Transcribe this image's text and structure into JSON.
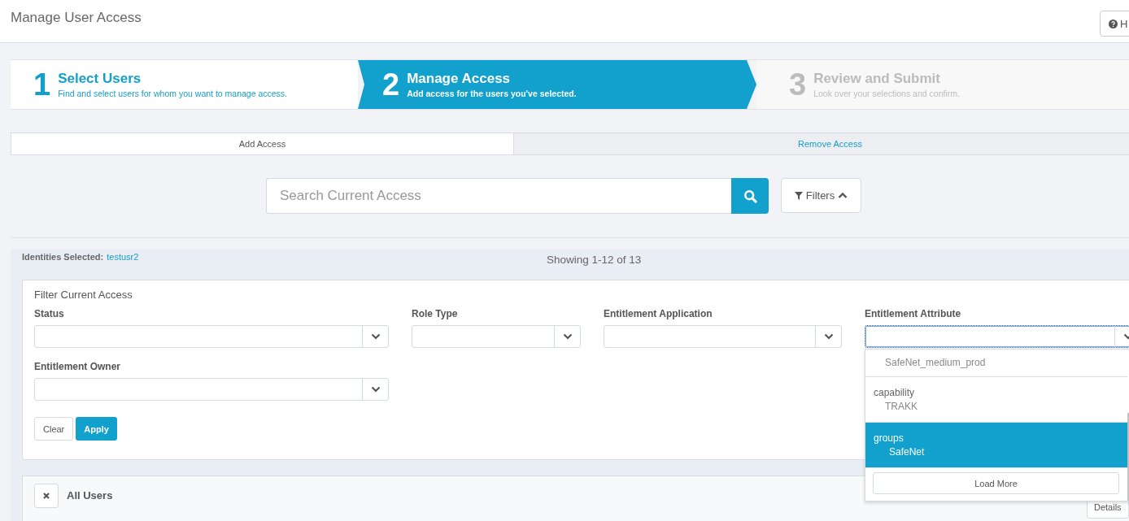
{
  "page": {
    "title": "Manage User Access",
    "help_button": "H"
  },
  "steps": [
    {
      "number": "1",
      "title": "Select Users",
      "description": "Find and select users for whom you want to manage access.",
      "selected": false
    },
    {
      "number": "2",
      "title": "Manage Access",
      "description": "Add access for the users you've selected.",
      "selected": true
    },
    {
      "number": "3",
      "title": "Review and Submit",
      "description": "Look over your selections and confirm.",
      "selected": false
    }
  ],
  "tabs": [
    {
      "label": "Add Access",
      "selected": true
    },
    {
      "label": "Remove Access",
      "selected": false
    }
  ],
  "search": {
    "placeholder": "Search Current Access"
  },
  "filters_button": {
    "label": "Filters",
    "expanded": true
  },
  "identities": {
    "label": "Identities Selected:",
    "user": "testusr2"
  },
  "showing": "Showing 1-12 of 13",
  "filter_panel": {
    "title": "Filter Current Access",
    "fields": [
      {
        "label": "Status",
        "focused": false
      },
      {
        "label": "Role Type",
        "focused": false
      },
      {
        "label": "Entitlement Application",
        "focused": false
      },
      {
        "label": "Entitlement Attribute",
        "focused": true,
        "dropdown": {
          "options": [
            {
              "value": "SafeNet_medium_prod",
              "selected": false
            },
            {
              "attribute": "capability",
              "value": "TRAKK",
              "selected": false
            },
            {
              "attribute": "groups",
              "value": "SafeNet",
              "selected": true
            }
          ],
          "load_more": "Load More"
        }
      },
      {
        "label": "Entitlement Owner",
        "focused": false
      }
    ],
    "clear": "Clear",
    "apply": "Apply"
  },
  "results": {
    "title": "All Users",
    "details_button": "Details"
  }
}
